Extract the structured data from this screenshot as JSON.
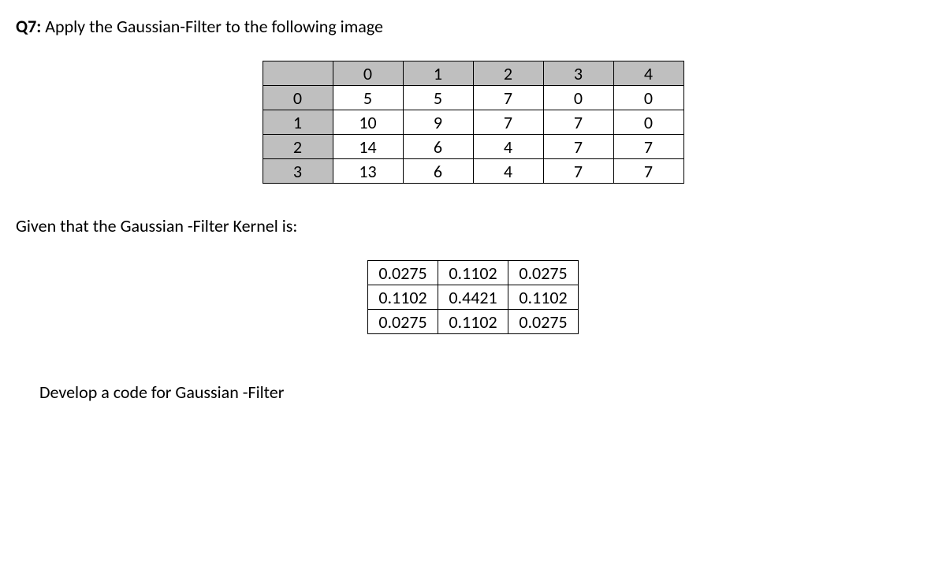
{
  "question": {
    "label": "Q7:",
    "text": " Apply the Gaussian-Filter to the following image"
  },
  "image_matrix": {
    "col_headers": [
      "0",
      "1",
      "2",
      "3",
      "4"
    ],
    "row_headers": [
      "0",
      "1",
      "2",
      "3"
    ],
    "rows": [
      [
        "5",
        "5",
        "7",
        "0",
        "0"
      ],
      [
        "10",
        "9",
        "7",
        "7",
        "0"
      ],
      [
        "14",
        "6",
        "4",
        "7",
        "7"
      ],
      [
        "13",
        "6",
        "4",
        "7",
        "7"
      ]
    ]
  },
  "given_text": "Given that the Gaussian -Filter Kernel is:",
  "kernel": [
    [
      "0.0275",
      "0.1102",
      "0.0275"
    ],
    [
      "0.1102",
      "0.4421",
      "0.1102"
    ],
    [
      "0.0275",
      "0.1102",
      "0.0275"
    ]
  ],
  "develop_text": "Develop a code for Gaussian -Filter"
}
